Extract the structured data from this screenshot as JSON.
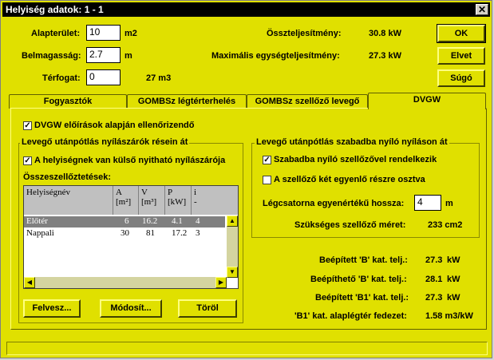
{
  "window": {
    "title": "Helyiség adatok: 1 - 1",
    "close_symbol": "✕",
    "bg": "#e0e000"
  },
  "top": {
    "alapterulet_label": "Alapterület:",
    "alapterulet_value": "10",
    "alapterulet_unit": "m2",
    "belmagassag_label": "Belmagasság:",
    "belmagassag_value": "2.7",
    "belmagassag_unit": "m",
    "terfogat_label": "Térfogat:",
    "terfogat_value": "0",
    "terfogat_result": "27 m3",
    "ossz_label": "Összteljesítmény:",
    "ossz_value": "30.8 kW",
    "max_label": "Maximális egységteljesítmény:",
    "max_value": "27.3 kW"
  },
  "buttons": {
    "ok": "OK",
    "elvet": "Elvet",
    "sugo": "Súgó"
  },
  "tabs": [
    {
      "label": "Fogyasztók"
    },
    {
      "label": "GOMBSz légtérterhelés"
    },
    {
      "label": "GOMBSz szellőző levegő"
    },
    {
      "label": "DVGW"
    }
  ],
  "dvgw": {
    "check_label": "DVGW előírások alapján ellenőrizendő",
    "left_group_title": "Levegő utánpótlás nyílászárók résein át",
    "left_check_label": "A helyiségnek van külső nyitható nyílászárója",
    "ossze_label": "Összeszellőztetések:",
    "table": {
      "headers": [
        {
          "top": "Helyiségnév",
          "bottom": ""
        },
        {
          "top": "A",
          "bottom": "[m²]"
        },
        {
          "top": "V",
          "bottom": "[m³]"
        },
        {
          "top": "P",
          "bottom": "[kW]"
        },
        {
          "top": "i",
          "bottom": "-"
        }
      ],
      "rows": [
        {
          "name": "Előtér",
          "a": "6",
          "v": "16.2",
          "p": "4.1",
          "i": "4"
        },
        {
          "name": "Nappali",
          "a": "30",
          "v": "81",
          "p": "17.2",
          "i": "3"
        }
      ]
    },
    "table_buttons": {
      "felvesz": "Felvesz...",
      "modosit": "Módosít...",
      "torol": "Töröl"
    },
    "right_group_title": "Levegő utánpótlás szabadba nyíló nyíláson át",
    "szabadba_label": "Szabadba nyíló szellőzővel rendelkezik",
    "ketegyenlo_label": "A szellőző két egyenlő részre osztva",
    "legcsatorna_label": "Légcsatorna egyenértékű hossza:",
    "legcsatorna_value": "4",
    "legcsatorna_unit": "m",
    "szukseges_label": "Szükséges szellőző méret:",
    "szukseges_value": "233 cm2",
    "results": [
      {
        "label": "Beépített 'B' kat. telj.:",
        "value": "27.3",
        "unit": "kW"
      },
      {
        "label": "Beépíthető 'B' kat. telj.:",
        "value": "28.1",
        "unit": "kW"
      },
      {
        "label": "Beépített 'B1' kat. telj.:",
        "value": "27.3",
        "unit": "kW"
      },
      {
        "label": "'B1' kat. alaplégtér fedezet:",
        "value": "1.58 m3/kW",
        "unit": ""
      }
    ]
  }
}
